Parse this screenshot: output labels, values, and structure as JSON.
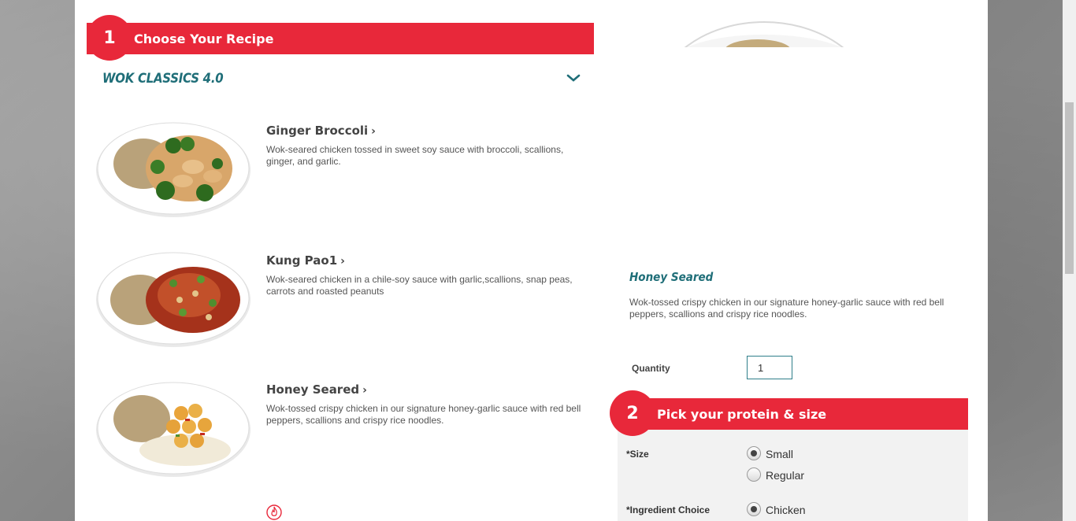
{
  "step1": {
    "number": "1",
    "label": "Choose Your Recipe"
  },
  "category": {
    "title": "WOK CLASSICS 4.0"
  },
  "recipes": [
    {
      "name": "Ginger Broccoli",
      "description": "Wok-seared chicken tossed in sweet soy sauce with broccoli, scallions, ginger, and garlic."
    },
    {
      "name": "Kung Pao1",
      "description": "Wok-seared chicken in a chile-soy sauce with garlic,scallions, snap peas, carrots and roasted peanuts"
    },
    {
      "name": "Honey Seared",
      "description": "Wok-tossed crispy chicken in our signature honey-garlic sauce with red bell peppers, scallions and crispy rice noodles."
    }
  ],
  "selected": {
    "title": "Honey Seared",
    "description": "Wok-tossed crispy chicken in our signature honey-garlic sauce with red bell peppers, scallions and crispy rice noodles.",
    "quantity_label": "Quantity",
    "quantity_value": "1"
  },
  "step2": {
    "number": "2",
    "label": "Pick your protein & size"
  },
  "options": {
    "size_label": "*Size",
    "size_choices": [
      {
        "label": "Small",
        "checked": true
      },
      {
        "label": "Regular",
        "checked": false
      }
    ],
    "ingredient_label": "*Ingredient Choice",
    "ingredient_choices": [
      {
        "label": "Chicken",
        "checked": true
      }
    ]
  },
  "colors": {
    "brand_red": "#e8283a",
    "accent_teal": "#1f6e78"
  }
}
